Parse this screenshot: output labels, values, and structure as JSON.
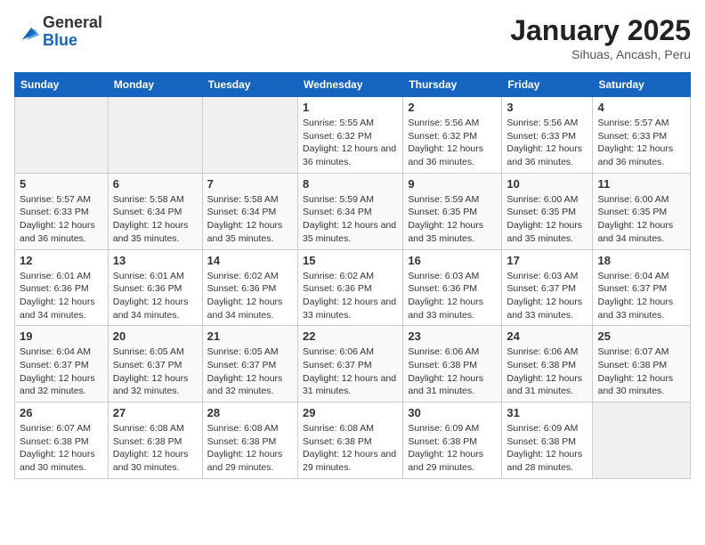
{
  "header": {
    "logo_general": "General",
    "logo_blue": "Blue",
    "title": "January 2025",
    "subtitle": "Sihuas, Ancash, Peru"
  },
  "weekdays": [
    "Sunday",
    "Monday",
    "Tuesday",
    "Wednesday",
    "Thursday",
    "Friday",
    "Saturday"
  ],
  "weeks": [
    [
      {
        "day": "",
        "empty": true
      },
      {
        "day": "",
        "empty": true
      },
      {
        "day": "",
        "empty": true
      },
      {
        "day": "1",
        "sunrise": "5:55 AM",
        "sunset": "6:32 PM",
        "daylight": "12 hours and 36 minutes."
      },
      {
        "day": "2",
        "sunrise": "5:56 AM",
        "sunset": "6:32 PM",
        "daylight": "12 hours and 36 minutes."
      },
      {
        "day": "3",
        "sunrise": "5:56 AM",
        "sunset": "6:33 PM",
        "daylight": "12 hours and 36 minutes."
      },
      {
        "day": "4",
        "sunrise": "5:57 AM",
        "sunset": "6:33 PM",
        "daylight": "12 hours and 36 minutes."
      }
    ],
    [
      {
        "day": "5",
        "sunrise": "5:57 AM",
        "sunset": "6:33 PM",
        "daylight": "12 hours and 36 minutes."
      },
      {
        "day": "6",
        "sunrise": "5:58 AM",
        "sunset": "6:34 PM",
        "daylight": "12 hours and 35 minutes."
      },
      {
        "day": "7",
        "sunrise": "5:58 AM",
        "sunset": "6:34 PM",
        "daylight": "12 hours and 35 minutes."
      },
      {
        "day": "8",
        "sunrise": "5:59 AM",
        "sunset": "6:34 PM",
        "daylight": "12 hours and 35 minutes."
      },
      {
        "day": "9",
        "sunrise": "5:59 AM",
        "sunset": "6:35 PM",
        "daylight": "12 hours and 35 minutes."
      },
      {
        "day": "10",
        "sunrise": "6:00 AM",
        "sunset": "6:35 PM",
        "daylight": "12 hours and 35 minutes."
      },
      {
        "day": "11",
        "sunrise": "6:00 AM",
        "sunset": "6:35 PM",
        "daylight": "12 hours and 34 minutes."
      }
    ],
    [
      {
        "day": "12",
        "sunrise": "6:01 AM",
        "sunset": "6:36 PM",
        "daylight": "12 hours and 34 minutes."
      },
      {
        "day": "13",
        "sunrise": "6:01 AM",
        "sunset": "6:36 PM",
        "daylight": "12 hours and 34 minutes."
      },
      {
        "day": "14",
        "sunrise": "6:02 AM",
        "sunset": "6:36 PM",
        "daylight": "12 hours and 34 minutes."
      },
      {
        "day": "15",
        "sunrise": "6:02 AM",
        "sunset": "6:36 PM",
        "daylight": "12 hours and 33 minutes."
      },
      {
        "day": "16",
        "sunrise": "6:03 AM",
        "sunset": "6:36 PM",
        "daylight": "12 hours and 33 minutes."
      },
      {
        "day": "17",
        "sunrise": "6:03 AM",
        "sunset": "6:37 PM",
        "daylight": "12 hours and 33 minutes."
      },
      {
        "day": "18",
        "sunrise": "6:04 AM",
        "sunset": "6:37 PM",
        "daylight": "12 hours and 33 minutes."
      }
    ],
    [
      {
        "day": "19",
        "sunrise": "6:04 AM",
        "sunset": "6:37 PM",
        "daylight": "12 hours and 32 minutes."
      },
      {
        "day": "20",
        "sunrise": "6:05 AM",
        "sunset": "6:37 PM",
        "daylight": "12 hours and 32 minutes."
      },
      {
        "day": "21",
        "sunrise": "6:05 AM",
        "sunset": "6:37 PM",
        "daylight": "12 hours and 32 minutes."
      },
      {
        "day": "22",
        "sunrise": "6:06 AM",
        "sunset": "6:37 PM",
        "daylight": "12 hours and 31 minutes."
      },
      {
        "day": "23",
        "sunrise": "6:06 AM",
        "sunset": "6:38 PM",
        "daylight": "12 hours and 31 minutes."
      },
      {
        "day": "24",
        "sunrise": "6:06 AM",
        "sunset": "6:38 PM",
        "daylight": "12 hours and 31 minutes."
      },
      {
        "day": "25",
        "sunrise": "6:07 AM",
        "sunset": "6:38 PM",
        "daylight": "12 hours and 30 minutes."
      }
    ],
    [
      {
        "day": "26",
        "sunrise": "6:07 AM",
        "sunset": "6:38 PM",
        "daylight": "12 hours and 30 minutes."
      },
      {
        "day": "27",
        "sunrise": "6:08 AM",
        "sunset": "6:38 PM",
        "daylight": "12 hours and 30 minutes."
      },
      {
        "day": "28",
        "sunrise": "6:08 AM",
        "sunset": "6:38 PM",
        "daylight": "12 hours and 29 minutes."
      },
      {
        "day": "29",
        "sunrise": "6:08 AM",
        "sunset": "6:38 PM",
        "daylight": "12 hours and 29 minutes."
      },
      {
        "day": "30",
        "sunrise": "6:09 AM",
        "sunset": "6:38 PM",
        "daylight": "12 hours and 29 minutes."
      },
      {
        "day": "31",
        "sunrise": "6:09 AM",
        "sunset": "6:38 PM",
        "daylight": "12 hours and 28 minutes."
      },
      {
        "day": "",
        "empty": true
      }
    ]
  ]
}
